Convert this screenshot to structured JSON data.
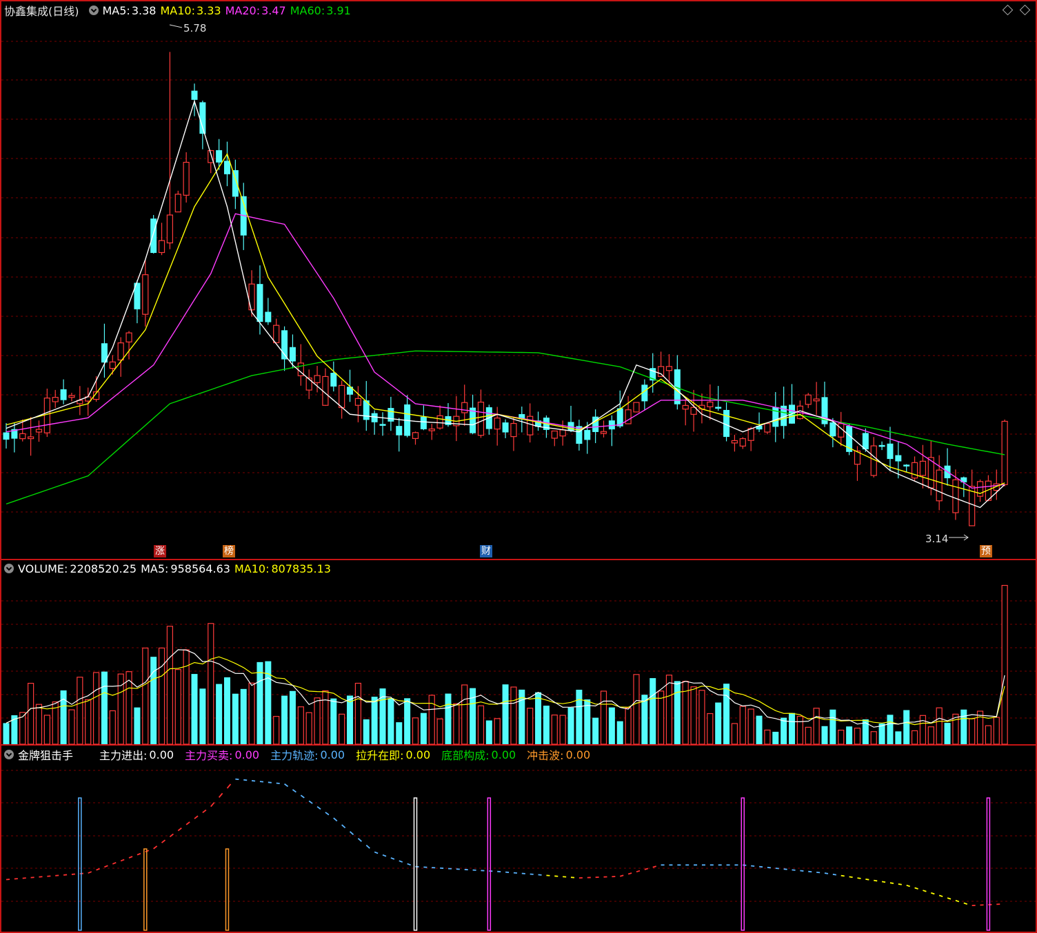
{
  "header": {
    "stock_name": "协鑫集成(日线)",
    "ma5_label": "MA5:",
    "ma5_value": "3.38",
    "ma10_label": "MA10:",
    "ma10_value": "3.33",
    "ma20_label": "MA20:",
    "ma20_value": "3.47",
    "ma60_label": "MA60:",
    "ma60_value": "3.91"
  },
  "colors": {
    "up": "#ff3b3b",
    "down": "#54fcfc",
    "ma5": "#ffffff",
    "ma10": "#ffff00",
    "ma20": "#ff3cff",
    "ma60": "#00d800",
    "grid": "#7a0000",
    "frame": "#c81414"
  },
  "annotations": {
    "high_label": "5.78",
    "low_label": "3.14"
  },
  "event_tags": [
    {
      "text": "涨",
      "color": "#b01818"
    },
    {
      "text": "榜",
      "color": "#c86414"
    },
    {
      "text": "财",
      "color": "#1f5fae"
    },
    {
      "text": "预",
      "color": "#c86414"
    }
  ],
  "volume_header": {
    "label": "VOLUME:",
    "value": "2208520.25",
    "ma5_label": "MA5:",
    "ma5_value": "958564.63",
    "ma10_label": "MA10:",
    "ma10_value": "807835.13"
  },
  "indicator_header": {
    "name": "金牌狙击手",
    "items": [
      {
        "label": "主力进出:",
        "value": "0.00",
        "color": "#ffffff"
      },
      {
        "label": "主力买卖:",
        "value": "0.00",
        "color": "#ff3cff"
      },
      {
        "label": "主力轨迹:",
        "value": "0.00",
        "color": "#5ab4ff"
      },
      {
        "label": "拉升在即:",
        "value": "0.00",
        "color": "#ffff00"
      },
      {
        "label": "底部构成:",
        "value": "0.00",
        "color": "#00d800"
      },
      {
        "label": "冲击波:",
        "value": "0.00",
        "color": "#ff9a2a"
      }
    ]
  },
  "chart_data": [
    {
      "type": "candlestick",
      "title": "协鑫集成(日线)",
      "ylim": [
        3.0,
        5.95
      ],
      "bars": 123,
      "ma_keypoints": {
        "ma5": [
          [
            0,
            3.64
          ],
          [
            10,
            3.82
          ],
          [
            13,
            4.1
          ],
          [
            17,
            4.6
          ],
          [
            20,
            5.05
          ],
          [
            23,
            5.5
          ],
          [
            27,
            4.9
          ],
          [
            30,
            4.3
          ],
          [
            35,
            4.0
          ],
          [
            42,
            3.72
          ],
          [
            50,
            3.68
          ],
          [
            57,
            3.66
          ],
          [
            60,
            3.72
          ],
          [
            65,
            3.65
          ],
          [
            70,
            3.62
          ],
          [
            75,
            3.78
          ],
          [
            77,
            4.0
          ],
          [
            80,
            3.95
          ],
          [
            85,
            3.72
          ],
          [
            90,
            3.62
          ],
          [
            97,
            3.74
          ],
          [
            101,
            3.68
          ],
          [
            108,
            3.4
          ],
          [
            115,
            3.26
          ],
          [
            119,
            3.19
          ],
          [
            122,
            3.32
          ]
        ],
        "ma10": [
          [
            0,
            3.66
          ],
          [
            10,
            3.78
          ],
          [
            17,
            4.2
          ],
          [
            23,
            4.9
          ],
          [
            27,
            5.2
          ],
          [
            32,
            4.5
          ],
          [
            38,
            4.05
          ],
          [
            45,
            3.75
          ],
          [
            55,
            3.68
          ],
          [
            60,
            3.72
          ],
          [
            70,
            3.63
          ],
          [
            75,
            3.75
          ],
          [
            80,
            3.92
          ],
          [
            85,
            3.75
          ],
          [
            92,
            3.66
          ],
          [
            97,
            3.72
          ],
          [
            102,
            3.55
          ],
          [
            108,
            3.42
          ],
          [
            115,
            3.32
          ],
          [
            119,
            3.27
          ],
          [
            122,
            3.33
          ]
        ],
        "ma20": [
          [
            0,
            3.62
          ],
          [
            10,
            3.7
          ],
          [
            18,
            4.0
          ],
          [
            25,
            4.52
          ],
          [
            28,
            4.86
          ],
          [
            34,
            4.8
          ],
          [
            40,
            4.38
          ],
          [
            45,
            3.96
          ],
          [
            50,
            3.78
          ],
          [
            60,
            3.72
          ],
          [
            70,
            3.64
          ],
          [
            75,
            3.66
          ],
          [
            80,
            3.8
          ],
          [
            90,
            3.8
          ],
          [
            100,
            3.7
          ],
          [
            110,
            3.55
          ],
          [
            118,
            3.3
          ],
          [
            122,
            3.32
          ]
        ],
        "ma60": [
          [
            0,
            3.21
          ],
          [
            10,
            3.37
          ],
          [
            20,
            3.78
          ],
          [
            30,
            3.94
          ],
          [
            40,
            4.03
          ],
          [
            50,
            4.08
          ],
          [
            65,
            4.07
          ],
          [
            75,
            3.99
          ],
          [
            85,
            3.82
          ],
          [
            95,
            3.73
          ],
          [
            105,
            3.65
          ],
          [
            115,
            3.55
          ],
          [
            122,
            3.49
          ]
        ]
      },
      "extremes": {
        "high": 5.78,
        "low": 3.14
      }
    },
    {
      "type": "bar",
      "title": "VOLUME",
      "ylim": [
        0,
        2300000
      ],
      "last_value": 2208520.25,
      "ma5": 958564.63,
      "ma10": 807835.13
    },
    {
      "type": "line",
      "title": "金牌狙击手",
      "series": [
        {
          "name": "主力进出",
          "value": 0.0
        },
        {
          "name": "主力买卖",
          "value": 0.0
        },
        {
          "name": "主力轨迹",
          "value": 0.0
        },
        {
          "name": "拉升在即",
          "value": 0.0
        },
        {
          "name": "底部构成",
          "value": 0.0
        },
        {
          "name": "冲击波",
          "value": 0.0
        }
      ]
    }
  ]
}
